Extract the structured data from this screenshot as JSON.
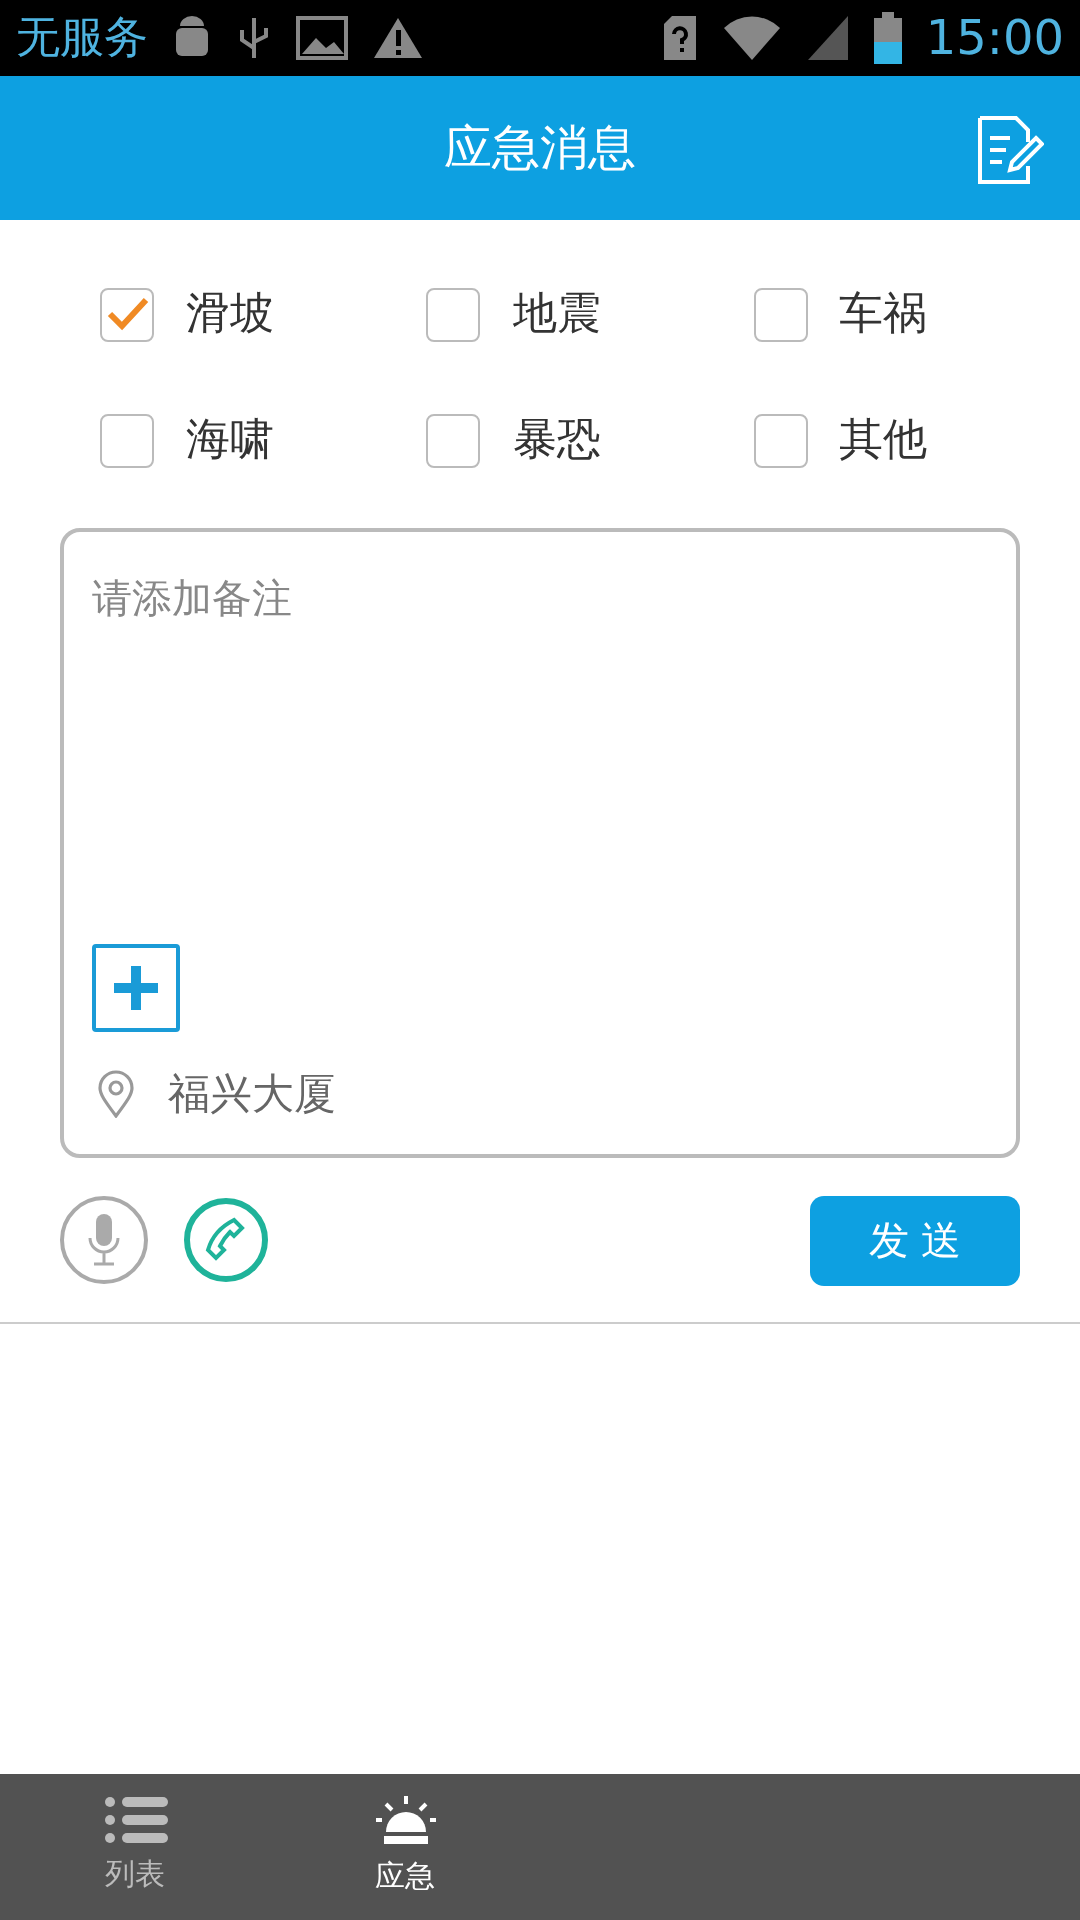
{
  "status_bar": {
    "carrier": "无服务",
    "time": "15:00"
  },
  "header": {
    "title": "应急消息"
  },
  "categories": [
    {
      "label": "滑坡",
      "checked": true
    },
    {
      "label": "地震",
      "checked": false
    },
    {
      "label": "车祸",
      "checked": false
    },
    {
      "label": "海啸",
      "checked": false
    },
    {
      "label": "暴恐",
      "checked": false
    },
    {
      "label": "其他",
      "checked": false
    }
  ],
  "note": {
    "placeholder": "请添加备注"
  },
  "location": "福兴大厦",
  "send_button": "发 送",
  "tabs": [
    {
      "label": "列表",
      "selected": false,
      "kind": "list"
    },
    {
      "label": "应急",
      "selected": true,
      "kind": "alarm"
    }
  ]
}
